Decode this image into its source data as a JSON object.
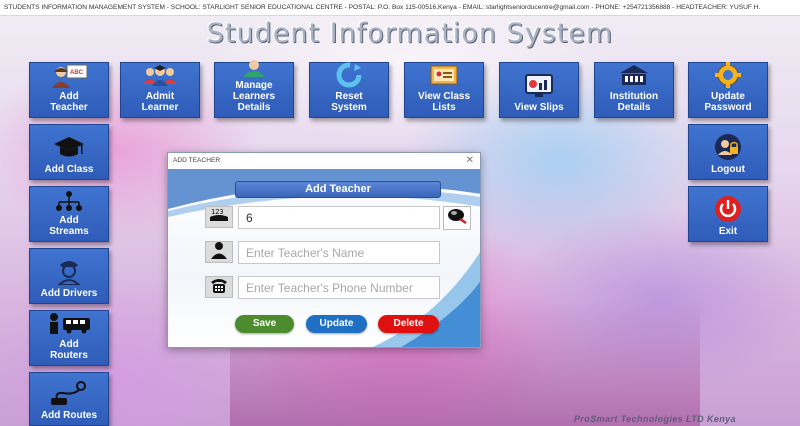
{
  "window": {
    "title": "STUDENTS INFORMATION MANAGEMENT SYSTEM - SCHOOL: STARLIGHT SENIOR EDUCATIONAL CENTRE - POSTAL: P.O. Box 115-00516,Kenya - EMAIL: starlightseniorducentre@gmail.com - PHONE: +254721356888 - HEADTEACHER: YUSUF H."
  },
  "app": {
    "title": "Student Information System"
  },
  "top_menu": [
    {
      "label": "Add\nTeacher",
      "icon": "teacher-icon"
    },
    {
      "label": "Admit\nLearner",
      "icon": "learners-icon"
    },
    {
      "label": "Manage\nLearners\nDetails",
      "icon": "manage-learner-icon"
    },
    {
      "label": "Reset\nSystem",
      "icon": "reset-icon"
    },
    {
      "label": "View Class\nLists",
      "icon": "class-list-icon"
    },
    {
      "label": "View Slips",
      "icon": "slips-icon"
    },
    {
      "label": "Institution\nDetails",
      "icon": "institution-icon"
    },
    {
      "label": "Update\nPassword",
      "icon": "gear-icon"
    }
  ],
  "left_menu": [
    {
      "label": "Add  Class",
      "icon": "graduation-cap-icon"
    },
    {
      "label": "Add\nStreams",
      "icon": "streams-icon"
    },
    {
      "label": "Add Drivers",
      "icon": "driver-icon"
    },
    {
      "label": "Add\nRouters",
      "icon": "bus-icon"
    },
    {
      "label": "Add Routes",
      "icon": "route-icon"
    }
  ],
  "right_menu": [
    {
      "label": "Logout",
      "icon": "logout-icon"
    },
    {
      "label": "Exit",
      "icon": "power-icon"
    }
  ],
  "dialog": {
    "title": "ADD TEACHER",
    "heading": "Add Teacher",
    "id_value": "6",
    "name_placeholder": "Enter Teacher's Name",
    "phone_placeholder": "Enter Teacher's Phone Number",
    "buttons": {
      "save": "Save",
      "update": "Update",
      "delete": "Delete"
    },
    "colors": {
      "save": "#4c8b2e",
      "update": "#1f6fc4",
      "delete": "#e11010"
    }
  },
  "footer": {
    "brand": "ProSmart  Technologies LTD Kenya"
  }
}
